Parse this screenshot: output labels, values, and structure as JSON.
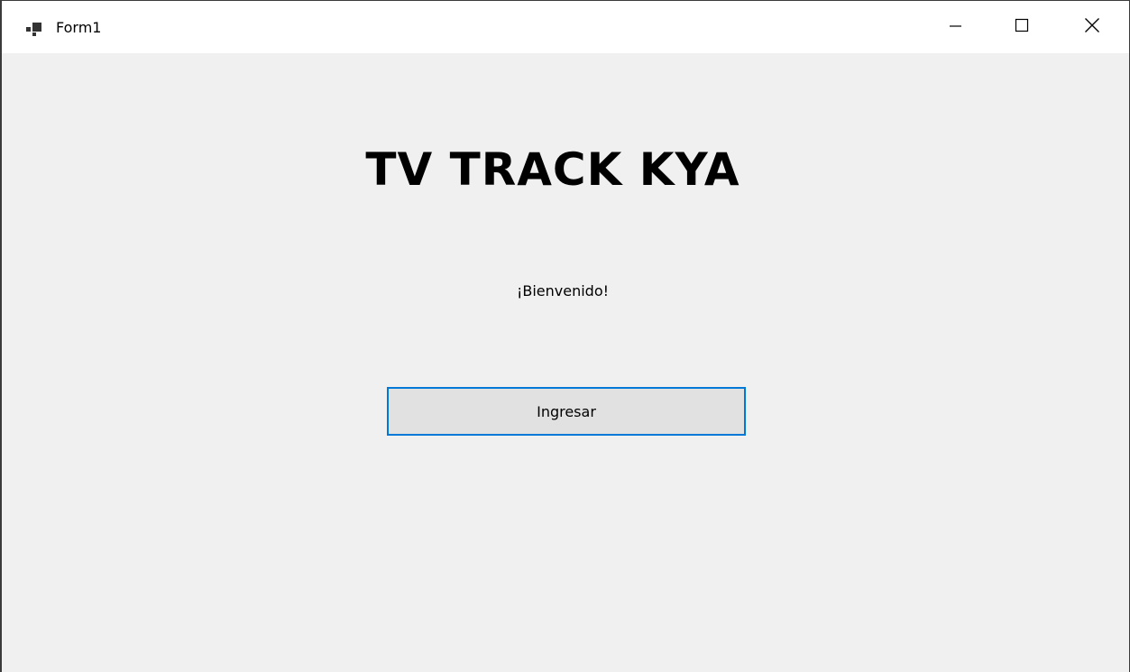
{
  "window": {
    "title": "Form1",
    "icon": "form-app-icon",
    "controls": {
      "minimize": "minimize-icon",
      "maximize": "maximize-icon",
      "close": "close-icon"
    }
  },
  "form": {
    "heading": "TV TRACK KYA",
    "welcome_text": "¡Bienvenido!",
    "enter_button_label": "Ingresar"
  },
  "colors": {
    "background": "#f0f0f0",
    "titlebar": "#ffffff",
    "button_border_focus": "#0078d7",
    "button_fill": "#e1e1e1"
  }
}
